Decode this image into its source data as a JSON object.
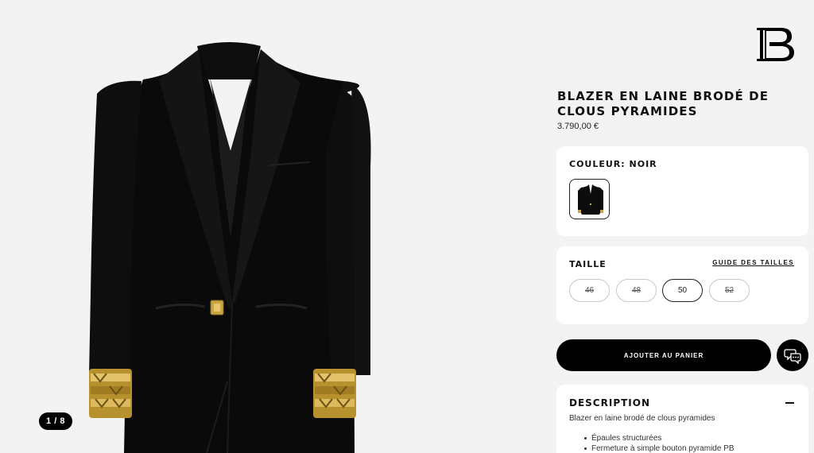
{
  "brand": {
    "logo_letter": "B"
  },
  "gallery": {
    "pager": "1 / 8"
  },
  "product": {
    "title": "BLAZER EN LAINE BRODÉ DE CLOUS PYRAMIDES",
    "price": "3.790,00 €"
  },
  "color": {
    "label": "COULEUR: NOIR",
    "swatch_icon": "black-blazer-thumbnail"
  },
  "size": {
    "label": "TAILLE",
    "guide_link": "GUIDE DES TAILLES",
    "options": [
      {
        "label": "46",
        "state": "unavailable"
      },
      {
        "label": "48",
        "state": "unavailable"
      },
      {
        "label": "50",
        "state": "selected"
      },
      {
        "label": "52",
        "state": "unavailable"
      }
    ]
  },
  "actions": {
    "add_to_cart": "AJOUTER AU PANIER",
    "chat_icon": "chat-bubbles-icon"
  },
  "description": {
    "label": "DESCRIPTION",
    "summary": "Blazer en laine brodé de clous pyramides",
    "bullets": [
      "Épaules structurées",
      "Fermeture à simple bouton pyramide PB"
    ]
  },
  "colors": {
    "background": "#f3f3f3",
    "card": "#ffffff",
    "primary": "#000000",
    "gold": "#c9a545"
  }
}
